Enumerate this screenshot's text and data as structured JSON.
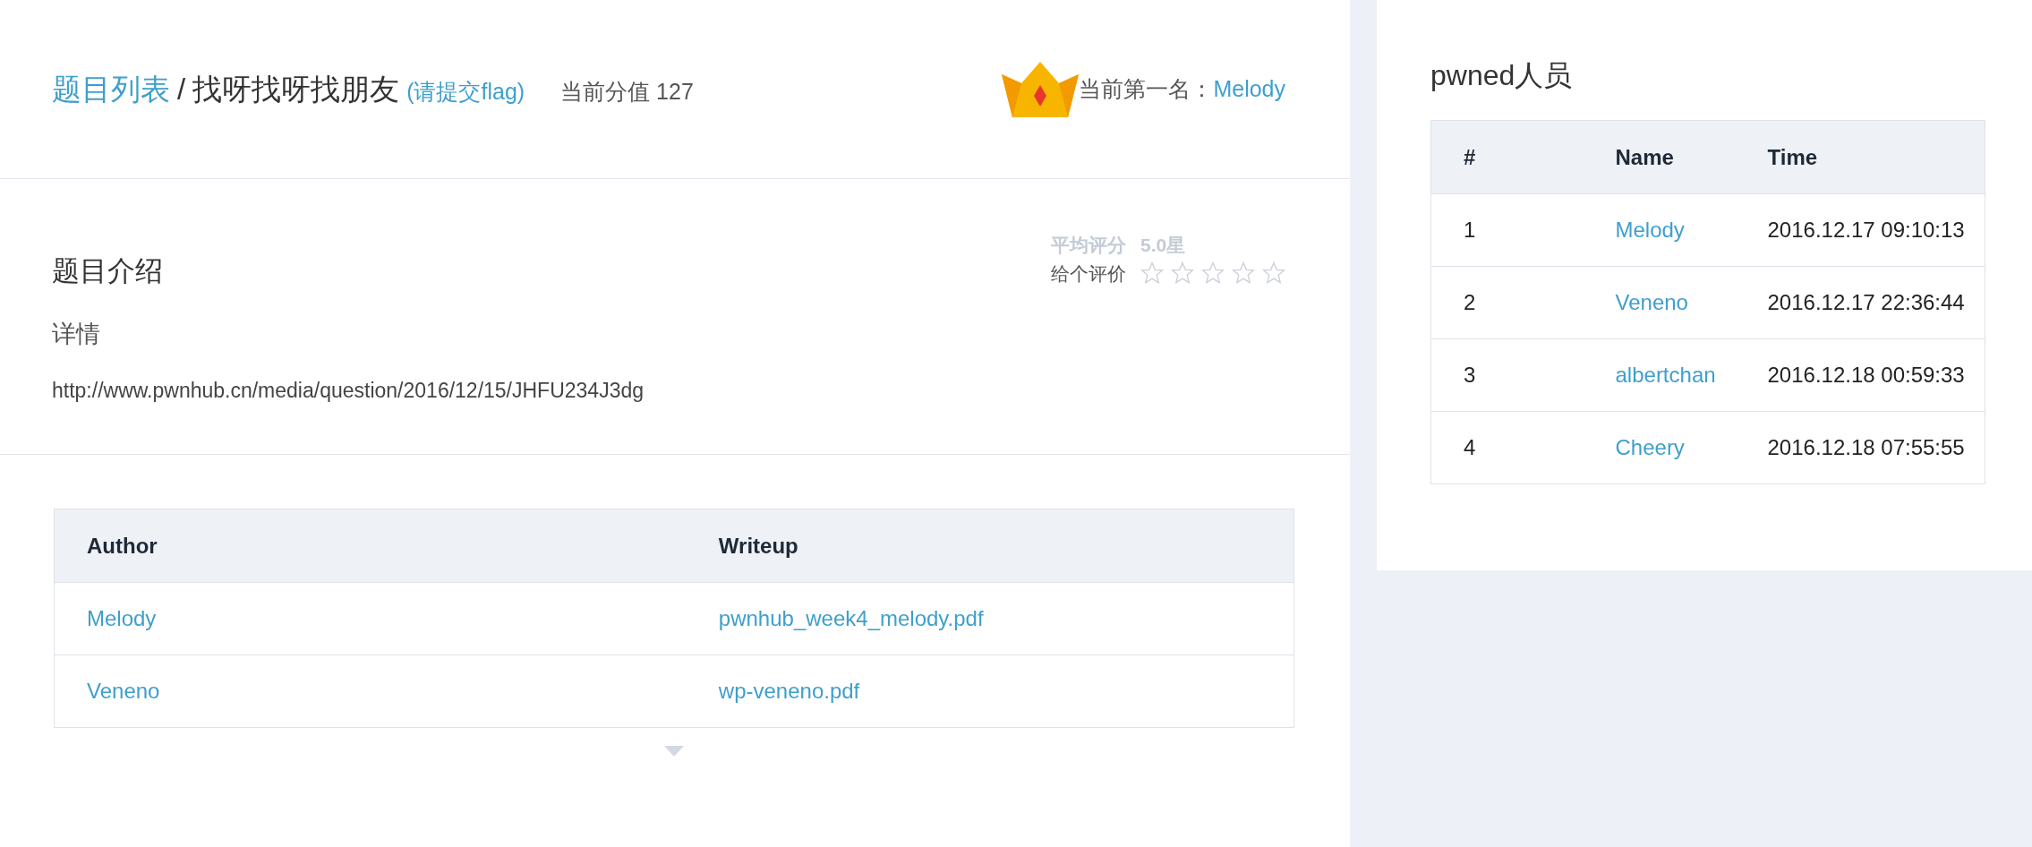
{
  "header": {
    "breadcrumb_link": "题目列表",
    "separator": "/",
    "title": "找呀找呀找朋友",
    "submit_link": "(请提交flag)",
    "score_label": "当前分值 127",
    "leader_label": "当前第一名：",
    "leader_name": "Melody"
  },
  "intro": {
    "heading": "题目介绍",
    "rating": {
      "average_label": "平均评分",
      "average_value": "5.0星",
      "give_label": "给个评价",
      "stars": 0
    },
    "details_label": "详情",
    "details_url": "http://www.pwnhub.cn/media/question/2016/12/15/JHFU234J3dg"
  },
  "writeups": {
    "columns": [
      "Author",
      "Writeup"
    ],
    "rows": [
      {
        "author": "Melody",
        "file": "pwnhub_week4_melody.pdf"
      },
      {
        "author": "Veneno",
        "file": "wp-veneno.pdf"
      }
    ]
  },
  "pwned": {
    "title": "pwned人员",
    "columns": [
      "#",
      "Name",
      "Time"
    ],
    "rows": [
      {
        "rank": "1",
        "name": "Melody",
        "time": "2016.12.17 09:10:13"
      },
      {
        "rank": "2",
        "name": "Veneno",
        "time": "2016.12.17 22:36:44"
      },
      {
        "rank": "3",
        "name": "albertchan",
        "time": "2016.12.18 00:59:33"
      },
      {
        "rank": "4",
        "name": "Cheery",
        "time": "2016.12.18 07:55:55"
      }
    ]
  }
}
